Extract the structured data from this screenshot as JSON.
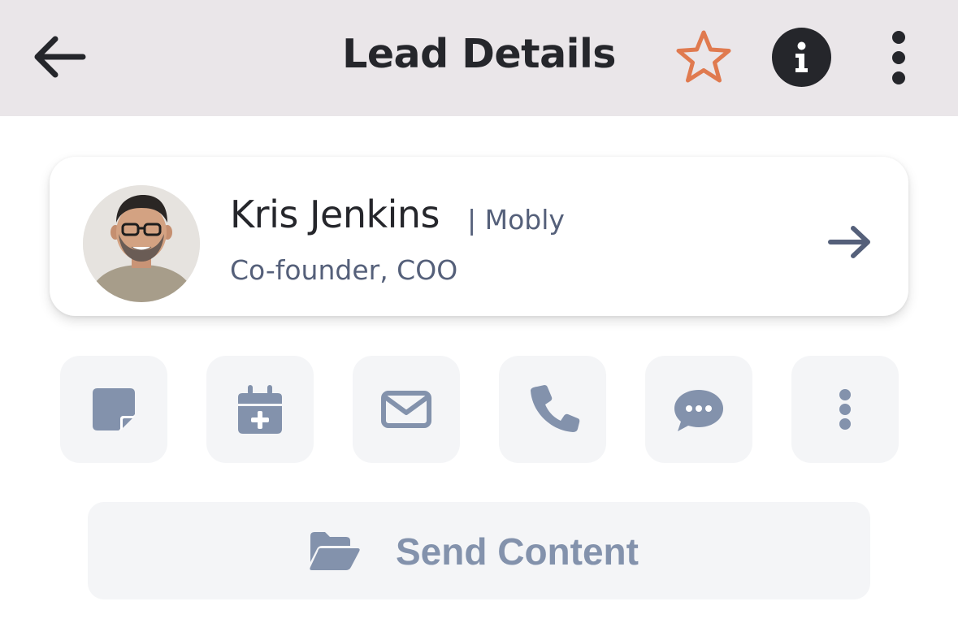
{
  "header": {
    "title": "Lead Details",
    "back_icon": "arrow-left-icon",
    "favorite_icon": "star-outline-icon",
    "info_icon": "info-icon",
    "more_icon": "kebab-vertical-icon",
    "favorite_color": "#e07a4f",
    "background": "#eae6e9"
  },
  "lead": {
    "name": "Kris Jenkins",
    "company": "| Mobly",
    "title": "Co-founder, COO",
    "avatar_icon": "avatar-photo",
    "open_icon": "arrow-right-icon"
  },
  "actions": [
    {
      "icon": "note-icon"
    },
    {
      "icon": "calendar-add-icon"
    },
    {
      "icon": "email-icon"
    },
    {
      "icon": "phone-icon"
    },
    {
      "icon": "chat-icon"
    },
    {
      "icon": "more-vertical-icon"
    }
  ],
  "send_content": {
    "label": "Send Content",
    "icon": "folder-open-icon"
  },
  "colors": {
    "accent_icon": "#8392ac",
    "tile_bg": "#f4f5f7",
    "text_dark": "#25262b",
    "text_muted": "#55607a"
  }
}
